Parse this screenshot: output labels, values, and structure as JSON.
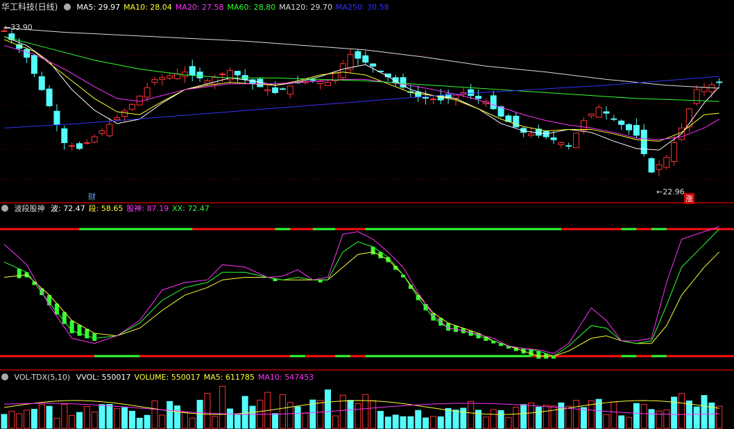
{
  "main_panel": {
    "title": "华工科技(日线)",
    "indicators": [
      {
        "label": "MA5: 29.97",
        "color": "#ffffff"
      },
      {
        "label": "MA10: 28.04",
        "color": "#ffff33"
      },
      {
        "label": "MA20: 27.58",
        "color": "#ff33ff"
      },
      {
        "label": "MA60: 28.80",
        "color": "#33ff33"
      },
      {
        "label": "MA120: 29.70",
        "color": "#dddddd"
      },
      {
        "label": "MA250: 30.58",
        "color": "#3333ff"
      }
    ],
    "high_marker": "33.90",
    "low_marker": "22.96",
    "badge_finance": "财",
    "badge_rise": "涨"
  },
  "wave_panel": {
    "title": "波段股神",
    "indicators": [
      {
        "label": "波: 72.47",
        "color": "#ffffff"
      },
      {
        "label": "段: 58.65",
        "color": "#ffff33"
      },
      {
        "label": "股神: 87.19",
        "color": "#ff33ff"
      },
      {
        "label": "XX: 72.47",
        "color": "#33ff33"
      }
    ]
  },
  "volume_panel": {
    "title": "VOL-TDX(5,10)",
    "indicators": [
      {
        "label": "VVOL: 550017",
        "color": "#ffffff"
      },
      {
        "label": "VOLUME: 550017",
        "color": "#ffff33"
      },
      {
        "label": "MA5: 611785",
        "color": "#ffff33"
      },
      {
        "label": "MA10: 547453",
        "color": "#ff33ff"
      }
    ]
  },
  "colors": {
    "up": "#ff3333",
    "down": "#54fcfc",
    "grid": "#8b0000",
    "bar_green": "#33ff33",
    "bar_red": "#ff1111"
  },
  "chart_data": {
    "type": "candlestick",
    "price_range": [
      22.96,
      33.9
    ],
    "ma_series": [
      {
        "name": "MA5",
        "points": [
          [
            0,
            33.2
          ],
          [
            3,
            32.6
          ],
          [
            6,
            31.5
          ],
          [
            9,
            29.6
          ],
          [
            12,
            28.2
          ],
          [
            15,
            27.3
          ],
          [
            18,
            27.6
          ],
          [
            21,
            28.7
          ],
          [
            24,
            29.6
          ],
          [
            27,
            30.0
          ],
          [
            30,
            30.4
          ],
          [
            33,
            30.2
          ],
          [
            36,
            29.9
          ],
          [
            39,
            30.1
          ],
          [
            42,
            30.5
          ],
          [
            45,
            31.0
          ],
          [
            48,
            31.3
          ],
          [
            51,
            30.5
          ],
          [
            54,
            29.6
          ],
          [
            57,
            29.2
          ],
          [
            60,
            29.0
          ],
          [
            63,
            28.3
          ],
          [
            66,
            27.3
          ],
          [
            69,
            26.8
          ],
          [
            72,
            26.6
          ],
          [
            75,
            26.9
          ],
          [
            78,
            26.7
          ],
          [
            81,
            26.1
          ],
          [
            84,
            25.6
          ],
          [
            87,
            25.5
          ],
          [
            90,
            26.6
          ],
          [
            93,
            28.7
          ],
          [
            95,
            29.8
          ]
        ]
      },
      {
        "name": "MA10",
        "points": [
          [
            0,
            33.0
          ],
          [
            4,
            32.2
          ],
          [
            8,
            30.6
          ],
          [
            12,
            29.0
          ],
          [
            15,
            28.1
          ],
          [
            18,
            27.9
          ],
          [
            21,
            28.8
          ],
          [
            24,
            29.6
          ],
          [
            27,
            29.9
          ],
          [
            30,
            30.1
          ],
          [
            33,
            30.0
          ],
          [
            36,
            29.9
          ],
          [
            39,
            30.2
          ],
          [
            42,
            30.6
          ],
          [
            45,
            30.8
          ],
          [
            48,
            30.6
          ],
          [
            51,
            30.0
          ],
          [
            54,
            29.4
          ],
          [
            57,
            29.2
          ],
          [
            60,
            28.9
          ],
          [
            63,
            28.3
          ],
          [
            66,
            27.6
          ],
          [
            69,
            27.1
          ],
          [
            72,
            26.8
          ],
          [
            75,
            26.9
          ],
          [
            78,
            26.9
          ],
          [
            81,
            26.6
          ],
          [
            84,
            26.2
          ],
          [
            87,
            26.1
          ],
          [
            90,
            26.7
          ],
          [
            93,
            27.9
          ],
          [
            95,
            28.0
          ]
        ]
      },
      {
        "name": "MA20",
        "points": [
          [
            0,
            32.6
          ],
          [
            4,
            32.0
          ],
          [
            8,
            31.0
          ],
          [
            12,
            29.8
          ],
          [
            15,
            29.0
          ],
          [
            18,
            28.8
          ],
          [
            21,
            29.2
          ],
          [
            24,
            29.6
          ],
          [
            27,
            29.8
          ],
          [
            30,
            30.0
          ],
          [
            33,
            30.0
          ],
          [
            36,
            30.0
          ],
          [
            39,
            30.1
          ],
          [
            42,
            30.2
          ],
          [
            45,
            30.3
          ],
          [
            48,
            30.3
          ],
          [
            51,
            30.1
          ],
          [
            54,
            29.9
          ],
          [
            57,
            29.6
          ],
          [
            60,
            29.3
          ],
          [
            63,
            28.9
          ],
          [
            66,
            28.4
          ],
          [
            69,
            27.9
          ],
          [
            72,
            27.5
          ],
          [
            75,
            27.2
          ],
          [
            78,
            27.0
          ],
          [
            81,
            26.7
          ],
          [
            84,
            26.3
          ],
          [
            87,
            26.2
          ],
          [
            90,
            26.4
          ],
          [
            93,
            27.0
          ],
          [
            95,
            27.6
          ]
        ]
      },
      {
        "name": "MA60",
        "points": [
          [
            0,
            33.2
          ],
          [
            6,
            32.4
          ],
          [
            12,
            31.6
          ],
          [
            18,
            31.0
          ],
          [
            24,
            30.6
          ],
          [
            30,
            30.4
          ],
          [
            36,
            30.4
          ],
          [
            42,
            30.3
          ],
          [
            48,
            30.2
          ],
          [
            54,
            30.0
          ],
          [
            60,
            29.8
          ],
          [
            66,
            29.6
          ],
          [
            72,
            29.4
          ],
          [
            78,
            29.2
          ],
          [
            84,
            29.0
          ],
          [
            90,
            28.9
          ],
          [
            95,
            28.8
          ]
        ]
      },
      {
        "name": "MA120",
        "points": [
          [
            0,
            33.8
          ],
          [
            8,
            33.5
          ],
          [
            16,
            33.3
          ],
          [
            24,
            33.1
          ],
          [
            32,
            32.9
          ],
          [
            40,
            32.6
          ],
          [
            48,
            32.3
          ],
          [
            56,
            31.8
          ],
          [
            64,
            31.2
          ],
          [
            72,
            30.8
          ],
          [
            80,
            30.3
          ],
          [
            88,
            29.9
          ],
          [
            95,
            29.7
          ]
        ]
      },
      {
        "name": "MA250",
        "points": [
          [
            0,
            27.0
          ],
          [
            10,
            27.3
          ],
          [
            20,
            27.7
          ],
          [
            30,
            28.1
          ],
          [
            40,
            28.5
          ],
          [
            50,
            28.9
          ],
          [
            60,
            29.3
          ],
          [
            70,
            29.6
          ],
          [
            80,
            29.9
          ],
          [
            90,
            30.3
          ],
          [
            95,
            30.5
          ]
        ]
      }
    ]
  }
}
